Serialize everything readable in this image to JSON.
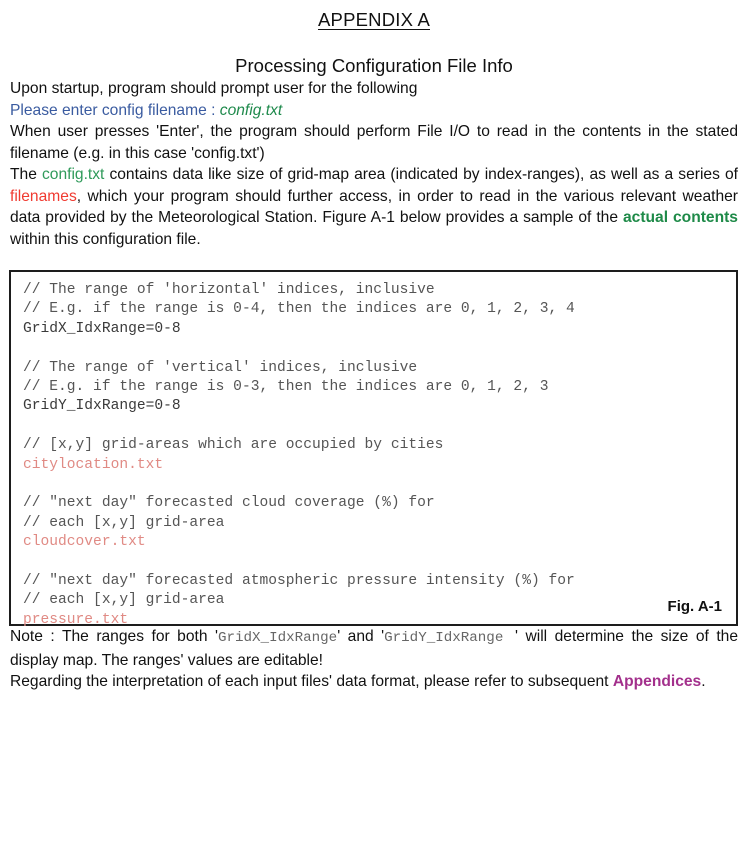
{
  "document": {
    "appendix_title": "APPENDIX A",
    "subtitle": "Processing Configuration File Info",
    "intro": "Upon startup, program should prompt user for the following",
    "prompt": {
      "label": "Please enter config filename : ",
      "value": "config.txt"
    },
    "paragraph_enter": {
      "part1": "When user presses 'Enter', the program should perform File I/O to read in the contents in the stated filename (e.g. in this case 'config.txt')"
    },
    "paragraph_config": {
      "part1": "The ",
      "highlight1": "config.txt",
      "part2": " contains data like size of grid-map area (indicated by index-ranges), as well as a series of ",
      "highlight2": "filenames",
      "part3": ", which your program should further access, in order to read in the various relevant weather data provided by the Meteorological Station. Figure A-1 below provides a sample of the ",
      "highlight3": "actual contents",
      "part4": " within this configuration file."
    }
  },
  "figure": {
    "label": "Fig. A-1",
    "lines": [
      {
        "kind": "comment",
        "text": "// The range of 'horizontal' indices, inclusive"
      },
      {
        "kind": "comment",
        "text": "// E.g. if the range is 0-4, then the indices are 0, 1, 2, 3, 4"
      },
      {
        "kind": "cfg",
        "text": "GridX_IdxRange=0-8"
      },
      {
        "kind": "blank",
        "text": ""
      },
      {
        "kind": "comment",
        "text": "// The range of 'vertical' indices, inclusive"
      },
      {
        "kind": "comment",
        "text": "// E.g. if the range is 0-3, then the indices are 0, 1, 2, 3"
      },
      {
        "kind": "cfg",
        "text": "GridY_IdxRange=0-8"
      },
      {
        "kind": "blank",
        "text": ""
      },
      {
        "kind": "comment",
        "text": "// [x,y] grid-areas which are occupied by cities"
      },
      {
        "kind": "file",
        "text": "citylocation.txt"
      },
      {
        "kind": "blank",
        "text": ""
      },
      {
        "kind": "comment",
        "text": "// \"next day\" forecasted cloud coverage (%) for"
      },
      {
        "kind": "comment",
        "text": "// each [x,y] grid-area"
      },
      {
        "kind": "file",
        "text": "cloudcover.txt"
      },
      {
        "kind": "blank",
        "text": ""
      },
      {
        "kind": "comment",
        "text": "// \"next day\" forecasted atmospheric pressure intensity (%) for"
      },
      {
        "kind": "comment",
        "text": "// each [x,y] grid-area"
      },
      {
        "kind": "file",
        "text": "pressure.txt"
      }
    ]
  },
  "notes": {
    "note": {
      "part1": "Note : The ranges for both '",
      "mono1": "GridX_IdxRange",
      "part2": "' and '",
      "mono2": "GridY_IdxRange ",
      "part3": "' will determine the size of the display map. The ranges' values are editable!"
    },
    "regarding": {
      "part1": "Regarding the interpretation of each input files' data format, please refer to subsequent ",
      "highlight": "Appendices",
      "part2": "."
    }
  },
  "colors": {
    "prompt_blue": "#3a5ba0",
    "value_green": "#1f8a4c",
    "inline_green": "#2f9a5a",
    "bold_green": "#1e8a48",
    "inline_red": "#f03a30",
    "file_red": "#e08a84",
    "appendices_purple": "#a3308c",
    "code_comment_gray": "#555555",
    "box_border": "#1d1d1d"
  }
}
